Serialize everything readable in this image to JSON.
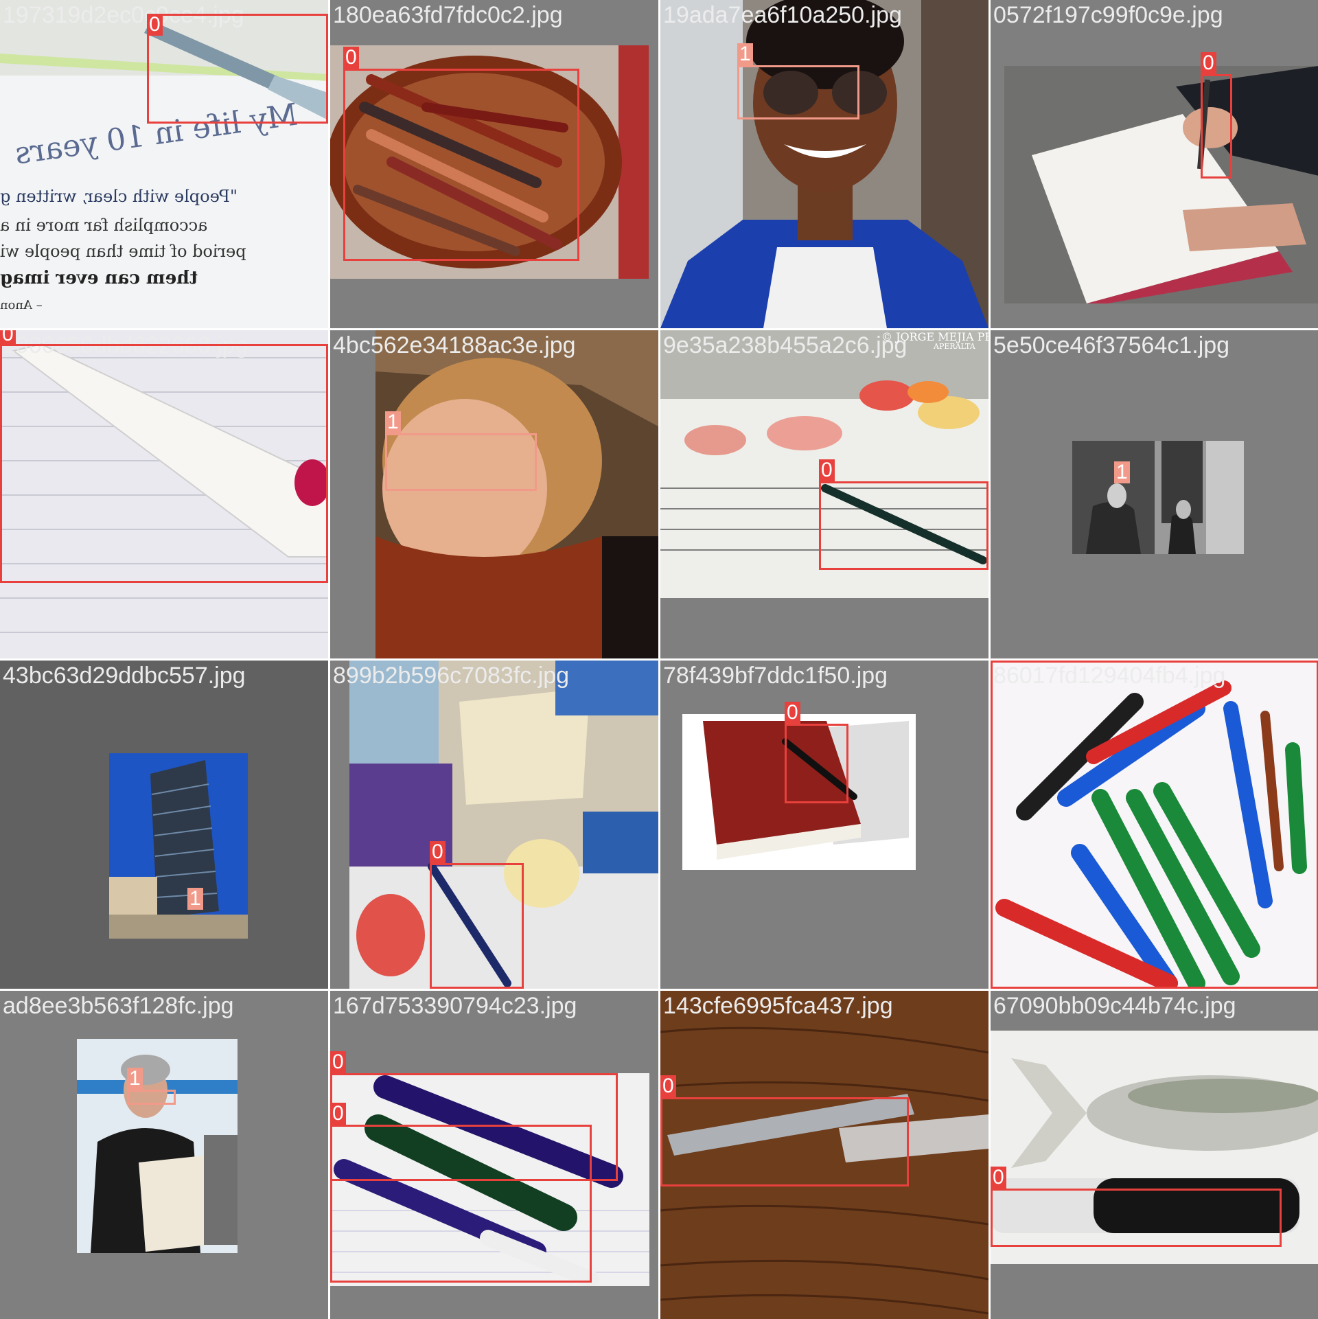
{
  "classes": {
    "0": "0",
    "1": "1"
  },
  "tiles": [
    {
      "file": "197319d2ec0c9ce4.jpg",
      "labels": [
        "0"
      ]
    },
    {
      "file": "180ea63fd7fdc0c2.jpg",
      "labels": [
        "0"
      ]
    },
    {
      "file": "19ada7ea6f10a250.jpg",
      "labels": [
        "1"
      ]
    },
    {
      "file": "0572f197c99f0c9e.jpg",
      "labels": [
        "0"
      ]
    },
    {
      "file": "1900650dbd622668.jpg",
      "labels": [
        "0"
      ]
    },
    {
      "file": "4bc562e34188ac3e.jpg",
      "labels": [
        "1"
      ]
    },
    {
      "file": "9e35a238b455a2c6.jpg",
      "labels": [
        "0"
      ],
      "watermark": "© JORGE MEJIA PER",
      "watermark2": "APERALTA"
    },
    {
      "file": "5e50ce46f37564c1.jpg",
      "labels": [
        "1"
      ]
    },
    {
      "file": "43bc63d29ddbc557.jpg",
      "labels": [
        "1"
      ]
    },
    {
      "file": "899b2b596c7083fc.jpg",
      "labels": [
        "0"
      ]
    },
    {
      "file": "78f439bf7ddc1f50.jpg",
      "labels": [
        "0"
      ]
    },
    {
      "file": "86017fd129404fb4.jpg",
      "labels": [
        "0"
      ]
    },
    {
      "file": "ad8ee3b563f128fc.jpg",
      "labels": [
        "1"
      ]
    },
    {
      "file": "167d753390794c23.jpg",
      "labels": [
        "0",
        "0"
      ]
    },
    {
      "file": "143cfe6995fca437.jpg",
      "labels": [
        "0"
      ]
    },
    {
      "file": "67090bb09c44b74c.jpg",
      "labels": [
        "0"
      ]
    }
  ],
  "tile0_text": [
    "My life in 10 years",
    "\"People with clear, written g",
    "accomplish far more in a",
    "period of time than people wi",
    "them can ever imag",
    "– Anon"
  ],
  "colors": {
    "box_class0": "#e8413d",
    "box_class1": "#f29a8a",
    "tile_bg": "#7f7f7f"
  }
}
